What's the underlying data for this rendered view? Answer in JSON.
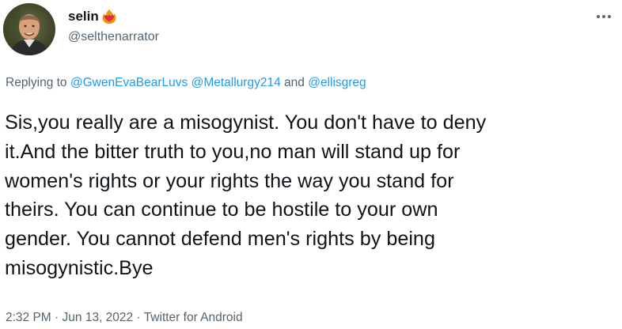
{
  "user": {
    "display_name": "selin",
    "badge_icon": "fire-heart-icon",
    "handle": "@selthenarrator"
  },
  "menu": {
    "icon": "more-horizontal-icon"
  },
  "reply": {
    "prefix": "Replying to",
    "mention_1": "@GwenEvaBearLuvs",
    "mention_2": "@Metallurgy214",
    "conjunction": "and",
    "mention_3": "@ellisgreg"
  },
  "tweet": {
    "lines": [
      "Sis,you really are a misogynist. You don't have to deny",
      "it.And the bitter truth to you,no man will stand up for",
      "women's rights or your rights the way you stand for",
      "theirs. You can continue to be hostile to your own",
      "gender. You cannot defend men's rights by being",
      "misogynistic.Bye"
    ]
  },
  "meta": {
    "time": "2:32 PM",
    "separator_1": "·",
    "date": "Jun 13, 2022",
    "separator_2": "·",
    "source": "Twitter for Android"
  },
  "colors": {
    "text": "#0f1419",
    "secondary": "#536471",
    "link": "#1d9bf0"
  }
}
